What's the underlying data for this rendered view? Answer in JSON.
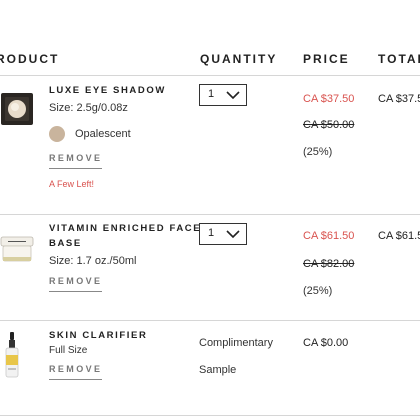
{
  "columns": {
    "product": "RODUCT",
    "quantity": "QUANTITY",
    "price": "PRICE",
    "total": "TOTAL"
  },
  "items": [
    {
      "name": "LUXE EYE SHADOW",
      "size": "Size: 2.5g/0.08z",
      "shade": "Opalescent",
      "shade_color": "#c9b49d",
      "remove_label": "REMOVE",
      "stock_note": "A Few Left!",
      "quantity": "1",
      "sale_price": "CA $37.50",
      "original_price": "CA $50.00",
      "discount": "(25%)",
      "total": "CA $37.5"
    },
    {
      "name_line1": "VITAMIN ENRICHED FACE",
      "name_line2": "BASE",
      "size": "Size: 1.7 oz./50ml",
      "remove_label": "REMOVE",
      "quantity": "1",
      "sale_price": "CA $61.50",
      "original_price": "CA $82.00",
      "discount": "(25%)",
      "total": "CA $61.5"
    },
    {
      "name": "SKIN CLARIFIER",
      "size": "Full Size",
      "remove_label": "REMOVE",
      "quantity_line1": "Complimentary",
      "quantity_line2": "Sample",
      "price": "CA $0.00"
    }
  ],
  "colors": {
    "sale": "#d9534f",
    "divider": "#d6d6d6",
    "text": "#222222"
  }
}
